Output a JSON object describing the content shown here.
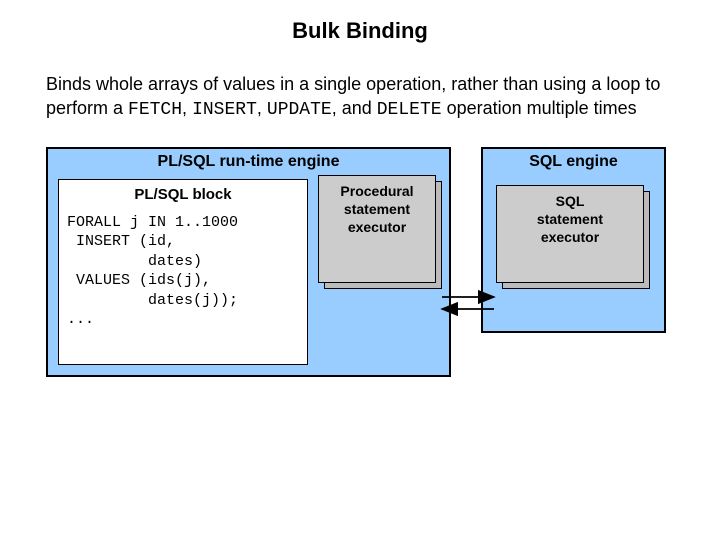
{
  "title": "Bulk Binding",
  "description": {
    "prefix": "Binds whole arrays of values in a single operation, rather than using a loop to perform a ",
    "kw1": "FETCH",
    "sep1": ", ",
    "kw2": "INSERT",
    "sep2": ", ",
    "kw3": "UPDATE",
    "sep3": ", and ",
    "kw4": "DELETE",
    "suffix": " operation multiple times"
  },
  "plsql_engine_label": "PL/SQL run-time engine",
  "sql_engine_label": "SQL engine",
  "plsql_block_label": "PL/SQL block",
  "code": "FORALL j IN 1..1000\n INSERT (id,\n         dates)\n VALUES (ids(j),\n         dates(j));\n...",
  "procedural_executor": "Procedural\nstatement\nexecutor",
  "sql_executor": "SQL\nstatement\nexecutor"
}
